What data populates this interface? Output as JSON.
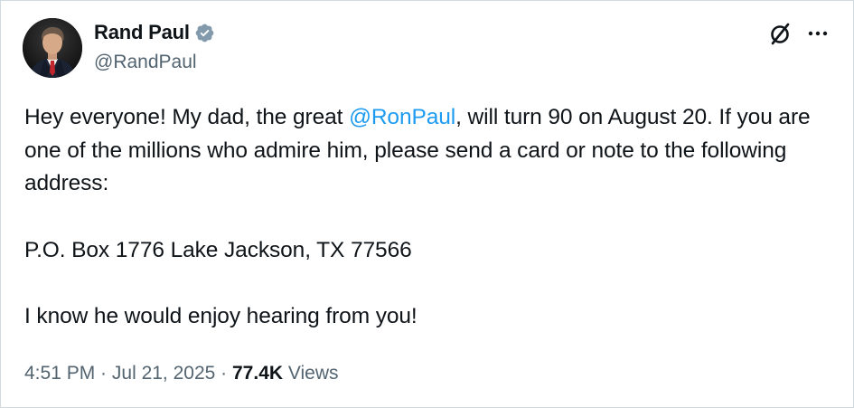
{
  "author": {
    "display_name": "Rand Paul",
    "handle": "@RandPaul",
    "verified": true,
    "verified_color": "#829aab"
  },
  "tweet": {
    "line1_before_mention": "Hey everyone! My dad, the great ",
    "mention": "@RonPaul",
    "line1_after_mention": ", will turn 90 on August 20.  If you are one of the millions who admire him, please send a card or note to the following address:",
    "address": "P.O. Box 1776 Lake Jackson, TX 77566",
    "closing": "I know he would enjoy hearing from you!"
  },
  "meta": {
    "time": "4:51 PM",
    "separator": " · ",
    "date": "Jul 21, 2025",
    "views_count": "77.4K",
    "views_label": "Views"
  },
  "colors": {
    "text": "#0f1419",
    "secondary": "#536471",
    "link": "#1d9bf0",
    "border": "#cfd9de"
  },
  "icons": {
    "grok": "grok-icon",
    "more": "more-options-icon"
  }
}
